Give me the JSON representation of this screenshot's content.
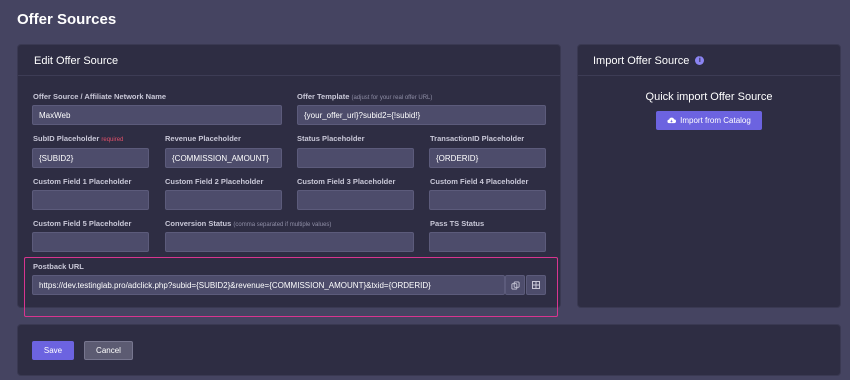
{
  "page_title": "Offer Sources",
  "edit_panel": {
    "title": "Edit Offer Source",
    "fields": {
      "network_name": {
        "label": "Offer Source / Affiliate Network Name",
        "value": "MaxWeb"
      },
      "offer_template": {
        "label": "Offer Template",
        "hint": "(adjust for your real offer URL)",
        "value": "{your_offer_url}?subid2={!subid!}"
      },
      "subid": {
        "label": "SubID Placeholder",
        "required": "required",
        "value": "{SUBID2}"
      },
      "revenue": {
        "label": "Revenue Placeholder",
        "value": "{COMMISSION_AMOUNT}"
      },
      "status": {
        "label": "Status Placeholder",
        "value": ""
      },
      "transaction_id": {
        "label": "TransactionID Placeholder",
        "value": "{ORDERID}"
      },
      "custom1": {
        "label": "Custom Field 1 Placeholder",
        "value": ""
      },
      "custom2": {
        "label": "Custom Field 2 Placeholder",
        "value": ""
      },
      "custom3": {
        "label": "Custom Field 3 Placeholder",
        "value": ""
      },
      "custom4": {
        "label": "Custom Field 4 Placeholder",
        "value": ""
      },
      "custom5": {
        "label": "Custom Field 5 Placeholder",
        "value": ""
      },
      "conversion_status": {
        "label": "Conversion Status",
        "hint": "(comma separated if multiple values)",
        "value": ""
      },
      "pass_ts": {
        "label": "Pass TS Status",
        "value": ""
      }
    },
    "postback": {
      "label": "Postback URL",
      "value": "https://dev.testinglab.pro/adclick.php?subid={SUBID2}&revenue={COMMISSION_AMOUNT}&txid={ORDERID}"
    }
  },
  "import_panel": {
    "title": "Import Offer Source",
    "heading": "Quick import Offer Source",
    "button_label": "Import from Catalog"
  },
  "footer": {
    "save_label": "Save",
    "cancel_label": "Cancel"
  },
  "colors": {
    "accent": "#6c63e0",
    "highlight_border": "#d8358f",
    "required": "#e2506a"
  }
}
